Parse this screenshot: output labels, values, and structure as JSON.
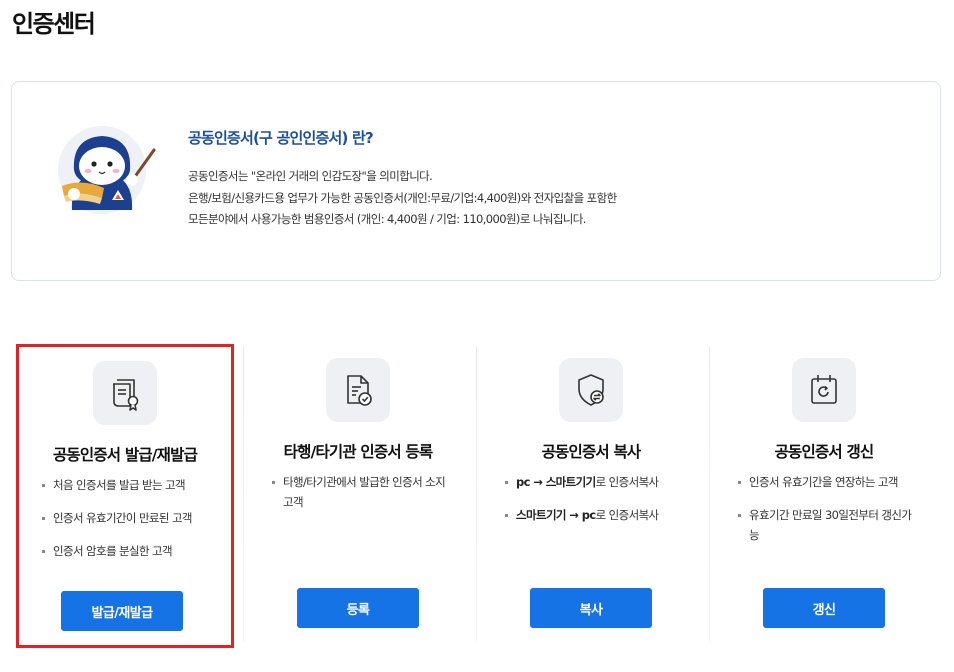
{
  "page": {
    "title": "인증센터"
  },
  "intro": {
    "heading": "공동인증서(구 공인인증서) 란?",
    "lines": [
      "공동인증서는 \"온라인 거래의 인감도장\"을 의미합니다.",
      "은행/보험/신용카드용 업무가 가능한 공동인증서(개인:무료/기업:4,400원)와 전자입찰을 포함한",
      "모든분야에서 사용가능한 범용인증서 (개인: 4,400원 / 기업: 110,000원)로 나눠집니다."
    ]
  },
  "cards": [
    {
      "icon": "certificate-icon",
      "title": "공동인증서 발급/재발급",
      "items": [
        "처음 인증서를 발급 받는 고객",
        "인증서 유효기간이 만료된 고객",
        "인증서 암호를 분실한 고객"
      ],
      "button": "발급/재발급",
      "selected": true
    },
    {
      "icon": "document-check-icon",
      "title": "타행/타기관 인증서 등록",
      "items": [
        "타행/타기관에서 발급한 인증서 소지고객"
      ],
      "button": "등록"
    },
    {
      "icon": "shield-transfer-icon",
      "title": "공동인증서 복사",
      "items": [
        {
          "bold": "pc → 스마트기기",
          "rest": "로 인증서복사"
        },
        {
          "bold": "스마트기기 → pc",
          "rest": "로 인증서복사"
        }
      ],
      "button": "복사"
    },
    {
      "icon": "calendar-renew-icon",
      "title": "공동인증서 갱신",
      "items": [
        "인증서 유효기간을 연장하는 고객",
        "유효기간 만료일 30일전부터 갱신가능"
      ],
      "button": "갱신"
    }
  ],
  "colors": {
    "accent": "#1573e6",
    "highlight": "#e52128",
    "heading": "#1d4f9f"
  }
}
